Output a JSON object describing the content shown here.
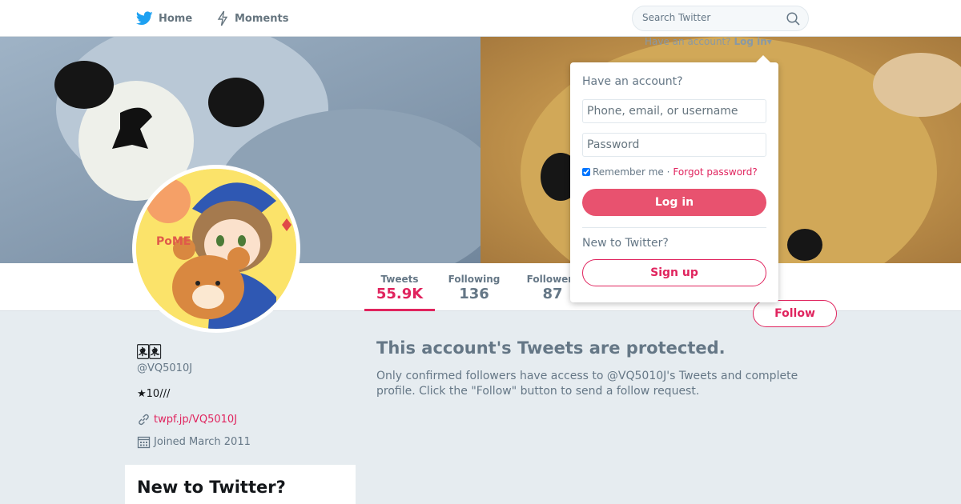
{
  "nav": {
    "home_label": "Home",
    "moments_label": "Moments",
    "search_placeholder": "Search Twitter",
    "have_account_text": "Have an account?",
    "login_link": "Log in"
  },
  "profile": {
    "display_name": "🀀🀀",
    "screen_name": "@VQ5010J",
    "bio": "★10///",
    "link_text": "twpf.jp/VQ5010J",
    "joined": "Joined March 2011",
    "follow_label": "Follow"
  },
  "stats": {
    "tweets_label": "Tweets",
    "tweets_value": "55.9K",
    "following_label": "Following",
    "following_value": "136",
    "followers_label": "Followers",
    "followers_value": "87"
  },
  "protected": {
    "title": "This account's Tweets are protected.",
    "text": "Only confirmed followers have access to @VQ5010J's Tweets and complete profile. Click the \"Follow\" button to send a follow request."
  },
  "signup_module": {
    "heading": "New to Twitter?"
  },
  "login_dropdown": {
    "heading": "Have an account?",
    "username_placeholder": "Phone, email, or username",
    "password_placeholder": "Password",
    "remember_label": "Remember me ·",
    "forgot_link": "Forgot password?",
    "login_button": "Log in",
    "new_heading": "New to Twitter?",
    "signup_button": "Sign up"
  },
  "colors": {
    "accent": "#e0245e",
    "login_button": "#e8526f",
    "background": "#e6ecf0",
    "twitter_blue": "#1da1f2"
  }
}
